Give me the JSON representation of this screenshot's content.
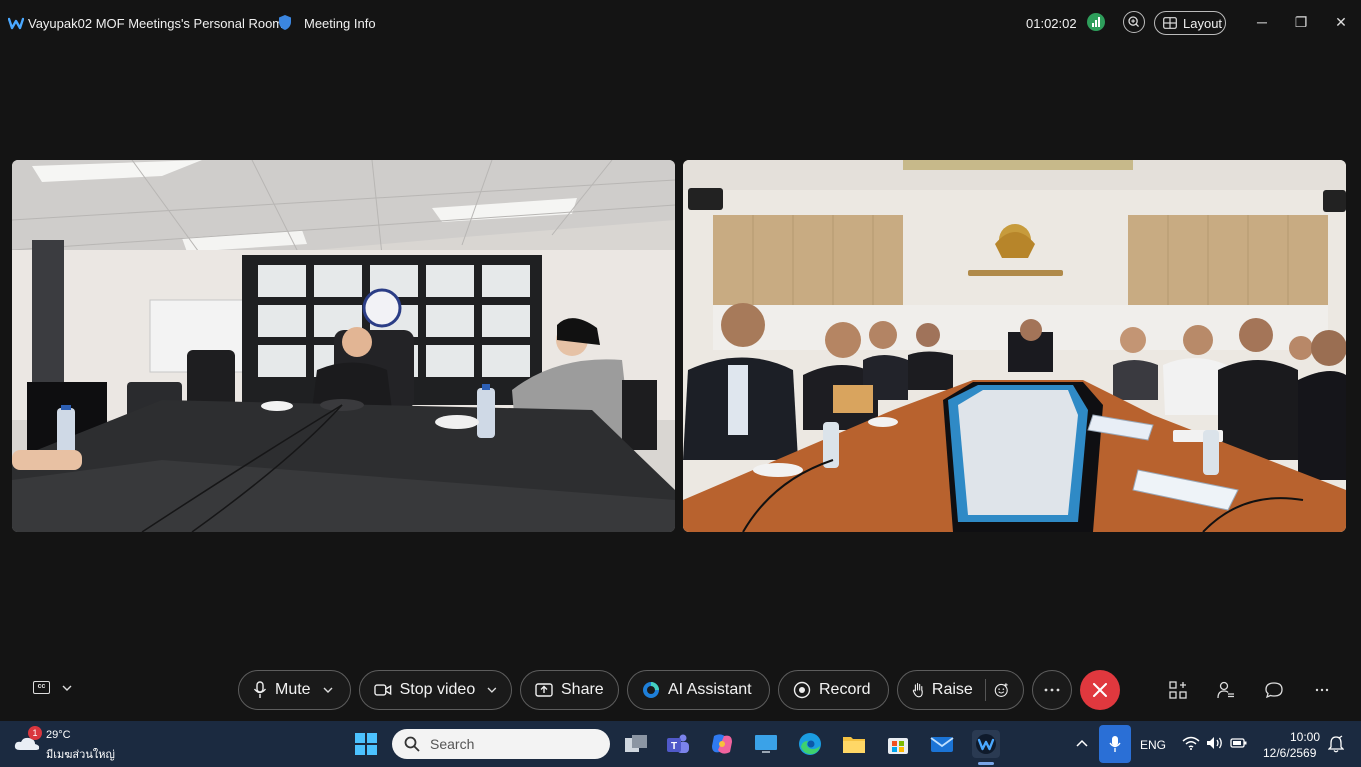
{
  "titlebar": {
    "room_title": "Vayupak02 MOF Meetings's Personal Room",
    "meeting_info": "Meeting Info",
    "timer": "01:02:02",
    "layout_label": "Layout"
  },
  "controls": {
    "mute": "Mute",
    "stop_video": "Stop video",
    "share": "Share",
    "ai_assistant": "AI Assistant",
    "record": "Record",
    "raise": "Raise"
  },
  "taskbar": {
    "weather_temp": "29°C",
    "weather_desc": "มีเมฆส่วนใหญ่",
    "weather_badge": "1",
    "search_placeholder": "Search",
    "language": "ENG",
    "time": "10:00",
    "date": "12/6/2569"
  },
  "colors": {
    "background": "#141414",
    "leave_red": "#e0383e",
    "signal_green": "#2e9e5b",
    "taskbar": "#1b2a40",
    "mic_active": "#2a6fd6"
  },
  "icons": {
    "signal": "signal-strength-icon",
    "zoom": "zoom-icon",
    "layout": "layout-grid-icon",
    "participants": "participants-icon",
    "chat": "chat-icon",
    "apps": "apps-icon"
  }
}
